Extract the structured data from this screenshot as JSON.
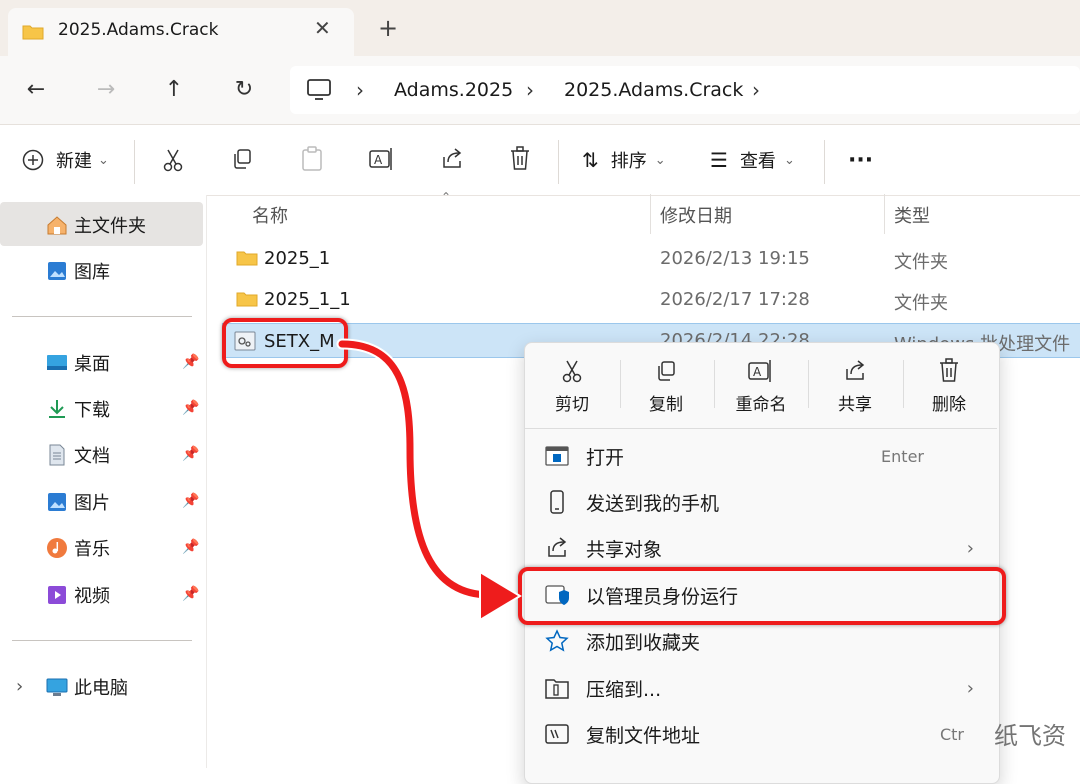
{
  "window": {
    "tab_title": "2025.Adams.Crack",
    "tab_close": "✕",
    "new_tab": "+"
  },
  "nav": {
    "back": "←",
    "forward": "→",
    "up": "↑",
    "refresh": "↻",
    "breadcrumbs": [
      "Adams.2025",
      "2025.Adams.Crack"
    ],
    "sep": "›"
  },
  "toolbar": {
    "new_label": "新建",
    "sort_label": "排序",
    "view_label": "查看",
    "more": "···",
    "chevron": "⌄"
  },
  "sidebar": {
    "items": [
      {
        "label": "主文件夹"
      },
      {
        "label": "图库"
      },
      {
        "label": "桌面"
      },
      {
        "label": "下载"
      },
      {
        "label": "文档"
      },
      {
        "label": "图片"
      },
      {
        "label": "音乐"
      },
      {
        "label": "视频"
      },
      {
        "label": "此电脑"
      }
    ],
    "expand": "›",
    "pin": "📌"
  },
  "columns": {
    "name": "名称",
    "date": "修改日期",
    "type": "类型"
  },
  "files": [
    {
      "name": "2025_1",
      "date": "2026/2/13 19:15",
      "type": "文件夹"
    },
    {
      "name": "2025_1_1",
      "date": "2026/2/17 17:28",
      "type": "文件夹"
    },
    {
      "name": "SETX_M",
      "date": "2026/2/14 22:28",
      "type": "Windows 批处理文件"
    }
  ],
  "context_menu": {
    "quick": [
      {
        "label": "剪切"
      },
      {
        "label": "复制"
      },
      {
        "label": "重命名"
      },
      {
        "label": "共享"
      },
      {
        "label": "删除"
      }
    ],
    "items": [
      {
        "label": "打开",
        "shortcut": "Enter"
      },
      {
        "label": "发送到我的手机"
      },
      {
        "label": "共享对象",
        "chevron": "›"
      },
      {
        "label": "以管理员身份运行"
      },
      {
        "label": "添加到收藏夹"
      },
      {
        "label": "压缩到...",
        "chevron": "›"
      },
      {
        "label": "复制文件地址",
        "shortcut": "Ctr"
      }
    ]
  },
  "watermark": "纸飞资",
  "colors": {
    "highlight": "#ee1c1c",
    "selection": "#cce4f7",
    "accent": "#0067c0"
  }
}
